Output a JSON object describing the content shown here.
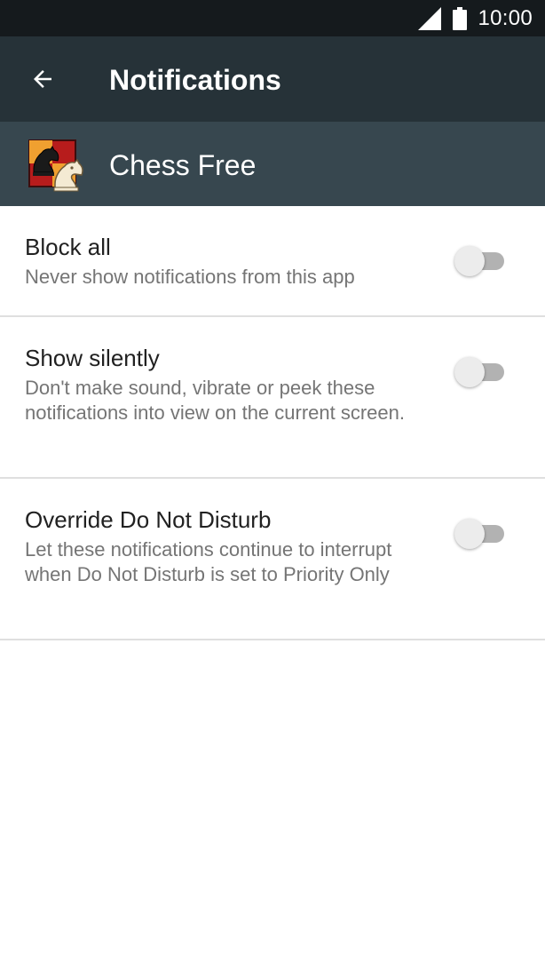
{
  "status_bar": {
    "time": "10:00",
    "signal_icon": "signal-icon",
    "battery_icon": "battery-icon"
  },
  "toolbar": {
    "back_icon": "back-arrow-icon",
    "title": "Notifications"
  },
  "app": {
    "name": "Chess Free",
    "icon": "chess-knight-icon"
  },
  "settings": [
    {
      "title": "Block all",
      "summary": "Never show notifications from this app",
      "enabled": false
    },
    {
      "title": "Show silently",
      "summary": "Don't make sound, vibrate or peek these notifications into view on the current screen.",
      "enabled": false
    },
    {
      "title": "Override Do Not Disturb",
      "summary": "Let these notifications continue to interrupt when Do Not Disturb is set to Priority Only",
      "enabled": false
    }
  ],
  "colors": {
    "status_bar": "#151a1d",
    "toolbar": "#263238",
    "app_header": "#37474f",
    "divider": "#dfdfdf",
    "switch_off_track": "#b2b2b2",
    "switch_off_thumb": "#ececec"
  }
}
